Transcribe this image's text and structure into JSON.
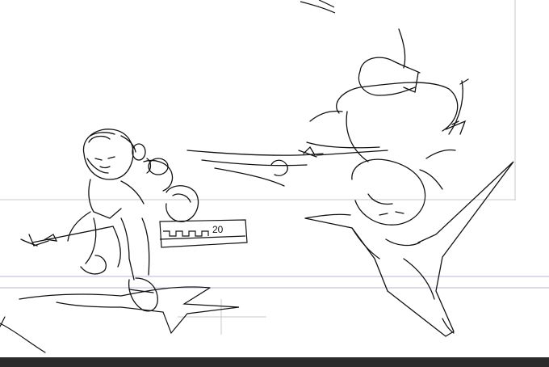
{
  "canvas": {
    "background": "#ffffff",
    "guide_color": "#b9b4d8",
    "frame_color": "#c8c8c8",
    "stroke_color": "#111111"
  },
  "sketch": {
    "badge_number": "20"
  },
  "bottom_bar": {
    "color": "#2b2b2b"
  }
}
